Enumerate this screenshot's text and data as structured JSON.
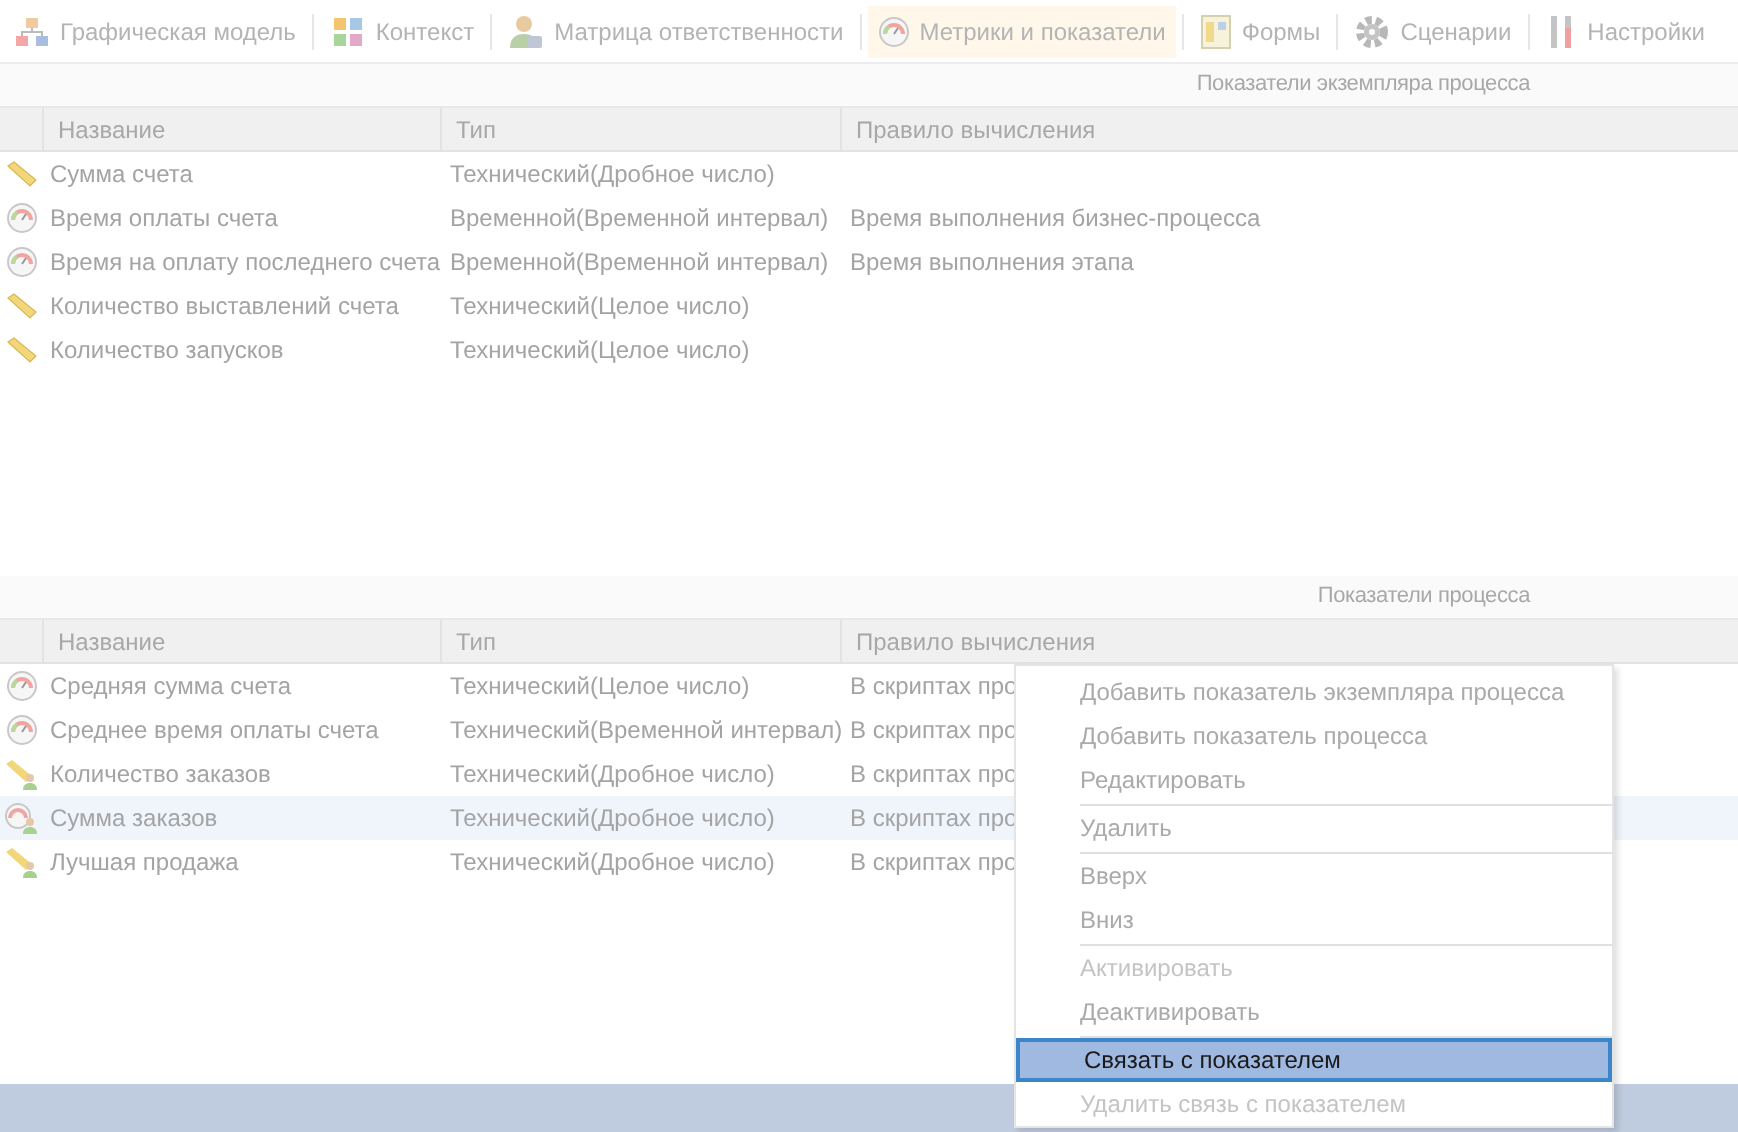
{
  "toolbar": {
    "tabs": [
      {
        "label": "Графическая модель",
        "kind": "model",
        "selected": false
      },
      {
        "label": "Контекст",
        "kind": "puzzle",
        "selected": false
      },
      {
        "label": "Матрица ответственности",
        "kind": "person",
        "selected": false
      },
      {
        "label": "Метрики и показатели",
        "kind": "gauge",
        "selected": true
      },
      {
        "label": "Формы",
        "kind": "form",
        "selected": false
      },
      {
        "label": "Сценарии",
        "kind": "gear",
        "selected": false
      },
      {
        "label": "Настройки",
        "kind": "tools",
        "selected": false
      }
    ]
  },
  "panels": [
    {
      "title": "Показатели экземпляра процесса",
      "columns": [
        "Название",
        "Тип",
        "Правило вычисления"
      ],
      "rows": [
        {
          "kind": "ruler",
          "name": "Сумма счета",
          "type": "Технический(Дробное число)",
          "rule": "",
          "selected": false
        },
        {
          "kind": "gauge",
          "name": "Время оплаты счета",
          "type": "Временной(Временной интервал)",
          "rule": "Время выполнения бизнес-процесса",
          "selected": false
        },
        {
          "kind": "gauge",
          "name": "Время на оплату последнего счета",
          "type": "Временной(Временной интервал)",
          "rule": "Время выполнения этапа",
          "selected": false
        },
        {
          "kind": "ruler",
          "name": "Количество выставлений счета",
          "type": "Технический(Целое число)",
          "rule": "",
          "selected": false
        },
        {
          "kind": "ruler",
          "name": "Количество запусков",
          "type": "Технический(Целое число)",
          "rule": "",
          "selected": false
        }
      ]
    },
    {
      "title": "Показатели процесса",
      "columns": [
        "Название",
        "Тип",
        "Правило вычисления"
      ],
      "rows": [
        {
          "kind": "gauge",
          "name": "Средняя сумма счета",
          "type": "Технический(Целое число)",
          "rule": "В скриптах про",
          "selected": false
        },
        {
          "kind": "gauge",
          "name": "Среднее время оплаты счета",
          "type": "Технический(Временной интервал)",
          "rule": "В скриптах про",
          "selected": false
        },
        {
          "kind": "ruler-user",
          "name": "Количество заказов",
          "type": "Технический(Дробное число)",
          "rule": "В скриптах про",
          "selected": false
        },
        {
          "kind": "gauge-user",
          "name": "Сумма заказов",
          "type": "Технический(Дробное число)",
          "rule": "В скриптах про",
          "selected": true
        },
        {
          "kind": "ruler-user",
          "name": "Лучшая продажа",
          "type": "Технический(Дробное число)",
          "rule": "В скриптах про",
          "selected": false
        }
      ]
    }
  ],
  "context_menu": {
    "items": [
      {
        "kind": "item",
        "label": "Добавить показатель экземпляра процесса",
        "disabled": false,
        "selected": false
      },
      {
        "kind": "item",
        "label": "Добавить показатель процесса",
        "disabled": false,
        "selected": false
      },
      {
        "kind": "item",
        "label": "Редактировать",
        "disabled": false,
        "selected": false
      },
      {
        "kind": "separator"
      },
      {
        "kind": "item",
        "label": "Удалить",
        "disabled": false,
        "selected": false
      },
      {
        "kind": "separator"
      },
      {
        "kind": "item",
        "label": "Вверх",
        "disabled": false,
        "selected": false
      },
      {
        "kind": "item",
        "label": "Вниз",
        "disabled": false,
        "selected": false
      },
      {
        "kind": "separator"
      },
      {
        "kind": "item",
        "label": "Активировать",
        "disabled": true,
        "selected": false
      },
      {
        "kind": "item",
        "label": "Деактивировать",
        "disabled": false,
        "selected": false
      },
      {
        "kind": "separator"
      },
      {
        "kind": "item",
        "label": "Связать с показателем",
        "disabled": false,
        "selected": true
      },
      {
        "kind": "item",
        "label": "Удалить связь с показателем",
        "disabled": true,
        "selected": false
      }
    ]
  }
}
